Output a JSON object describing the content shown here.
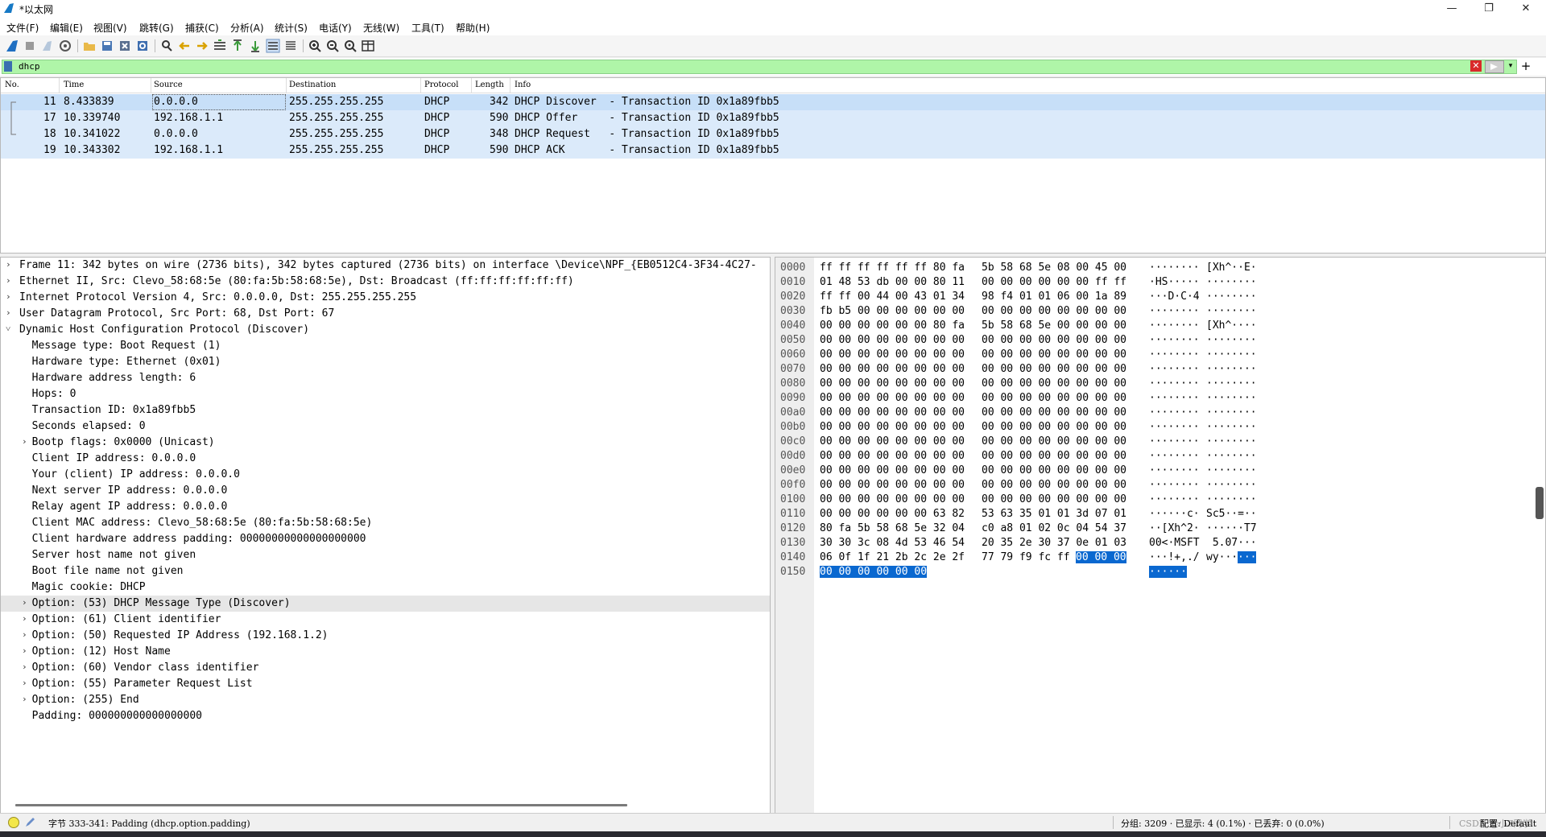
{
  "window": {
    "title": "*以太网",
    "minimize": "—",
    "maximize": "❐",
    "close": "✕"
  },
  "menu": [
    "文件(F)",
    "编辑(E)",
    "视图(V)",
    "跳转(G)",
    "捕获(C)",
    "分析(A)",
    "统计(S)",
    "电话(Y)",
    "无线(W)",
    "工具(T)",
    "帮助(H)"
  ],
  "toolbar_icons": [
    "shark-start-icon",
    "stop-icon",
    "restart-icon",
    "options-icon",
    "open-file-icon",
    "save-file-icon",
    "close-file-icon",
    "reload-icon",
    "find-icon",
    "go-back-icon",
    "go-forward-icon",
    "go-to-packet-icon",
    "first-packet-icon",
    "last-packet-icon",
    "autoscroll-icon",
    "colorize-icon",
    "zoom-in-icon",
    "zoom-out-icon",
    "normal-size-icon",
    "resize-columns-icon"
  ],
  "filter": {
    "value": "dhcp",
    "clear": "✕",
    "dropdown": "▾",
    "add": "+"
  },
  "packet_list": {
    "columns": [
      "No.",
      "Time",
      "Source",
      "Destination",
      "Protocol",
      "Length",
      "Info"
    ],
    "rows": [
      {
        "no": "11",
        "time": "8.433839",
        "source": "0.0.0.0",
        "destination": "255.255.255.255",
        "protocol": "DHCP",
        "length": "342",
        "info": "DHCP Discover  - Transaction ID 0x1a89fbb5"
      },
      {
        "no": "17",
        "time": "10.339740",
        "source": "192.168.1.1",
        "destination": "255.255.255.255",
        "protocol": "DHCP",
        "length": "590",
        "info": "DHCP Offer     - Transaction ID 0x1a89fbb5"
      },
      {
        "no": "18",
        "time": "10.341022",
        "source": "0.0.0.0",
        "destination": "255.255.255.255",
        "protocol": "DHCP",
        "length": "348",
        "info": "DHCP Request   - Transaction ID 0x1a89fbb5"
      },
      {
        "no": "19",
        "time": "10.343302",
        "source": "192.168.1.1",
        "destination": "255.255.255.255",
        "protocol": "DHCP",
        "length": "590",
        "info": "DHCP ACK       - Transaction ID 0x1a89fbb5"
      }
    ]
  },
  "details": [
    {
      "arrow": "›",
      "text": "Frame 11: 342 bytes on wire (2736 bits), 342 bytes captured (2736 bits) on interface \\Device\\NPF_{EB0512C4-3F34-4C27-"
    },
    {
      "arrow": "›",
      "text": "Ethernet II, Src: Clevo_58:68:5e (80:fa:5b:58:68:5e), Dst: Broadcast (ff:ff:ff:ff:ff:ff)"
    },
    {
      "arrow": "›",
      "text": "Internet Protocol Version 4, Src: 0.0.0.0, Dst: 255.255.255.255"
    },
    {
      "arrow": "›",
      "text": "User Datagram Protocol, Src Port: 68, Dst Port: 67"
    },
    {
      "arrow": "˅",
      "text": "Dynamic Host Configuration Protocol (Discover)"
    },
    {
      "arrow": "",
      "text": "  Message type: Boot Request (1)"
    },
    {
      "arrow": "",
      "text": "  Hardware type: Ethernet (0x01)"
    },
    {
      "arrow": "",
      "text": "  Hardware address length: 6"
    },
    {
      "arrow": "",
      "text": "  Hops: 0"
    },
    {
      "arrow": "",
      "text": "  Transaction ID: 0x1a89fbb5"
    },
    {
      "arrow": "",
      "text": "  Seconds elapsed: 0"
    },
    {
      "arrow": "›",
      "text": "  Bootp flags: 0x0000 (Unicast)"
    },
    {
      "arrow": "",
      "text": "  Client IP address: 0.0.0.0"
    },
    {
      "arrow": "",
      "text": "  Your (client) IP address: 0.0.0.0"
    },
    {
      "arrow": "",
      "text": "  Next server IP address: 0.0.0.0"
    },
    {
      "arrow": "",
      "text": "  Relay agent IP address: 0.0.0.0"
    },
    {
      "arrow": "",
      "text": "  Client MAC address: Clevo_58:68:5e (80:fa:5b:58:68:5e)"
    },
    {
      "arrow": "",
      "text": "  Client hardware address padding: 00000000000000000000"
    },
    {
      "arrow": "",
      "text": "  Server host name not given"
    },
    {
      "arrow": "",
      "text": "  Boot file name not given"
    },
    {
      "arrow": "",
      "text": "  Magic cookie: DHCP"
    },
    {
      "arrow": "›",
      "text": "  Option: (53) DHCP Message Type (Discover)",
      "highlight": true
    },
    {
      "arrow": "›",
      "text": "  Option: (61) Client identifier"
    },
    {
      "arrow": "›",
      "text": "  Option: (50) Requested IP Address (192.168.1.2)"
    },
    {
      "arrow": "›",
      "text": "  Option: (12) Host Name"
    },
    {
      "arrow": "›",
      "text": "  Option: (60) Vendor class identifier"
    },
    {
      "arrow": "›",
      "text": "  Option: (55) Parameter Request List"
    },
    {
      "arrow": "›",
      "text": "  Option: (255) End"
    },
    {
      "arrow": "",
      "text": "  Padding: 000000000000000000"
    }
  ],
  "bytes": [
    {
      "off": "0000",
      "h1": "ff ff ff ff ff ff 80 fa",
      "h2": "5b 58 68 5e 08 00 45 00",
      "a1": "········",
      "a2": "[Xh^··E·"
    },
    {
      "off": "0010",
      "h1": "01 48 53 db 00 00 80 11",
      "h2": "00 00 00 00 00 00 ff ff",
      "a1": "·HS·····",
      "a2": "········"
    },
    {
      "off": "0020",
      "h1": "ff ff 00 44 00 43 01 34",
      "h2": "98 f4 01 01 06 00 1a 89",
      "a1": "···D·C·4",
      "a2": "········"
    },
    {
      "off": "0030",
      "h1": "fb b5 00 00 00 00 00 00",
      "h2": "00 00 00 00 00 00 00 00",
      "a1": "········",
      "a2": "········"
    },
    {
      "off": "0040",
      "h1": "00 00 00 00 00 00 80 fa",
      "h2": "5b 58 68 5e 00 00 00 00",
      "a1": "········",
      "a2": "[Xh^····"
    },
    {
      "off": "0050",
      "h1": "00 00 00 00 00 00 00 00",
      "h2": "00 00 00 00 00 00 00 00",
      "a1": "········",
      "a2": "········"
    },
    {
      "off": "0060",
      "h1": "00 00 00 00 00 00 00 00",
      "h2": "00 00 00 00 00 00 00 00",
      "a1": "········",
      "a2": "········"
    },
    {
      "off": "0070",
      "h1": "00 00 00 00 00 00 00 00",
      "h2": "00 00 00 00 00 00 00 00",
      "a1": "········",
      "a2": "········"
    },
    {
      "off": "0080",
      "h1": "00 00 00 00 00 00 00 00",
      "h2": "00 00 00 00 00 00 00 00",
      "a1": "········",
      "a2": "········"
    },
    {
      "off": "0090",
      "h1": "00 00 00 00 00 00 00 00",
      "h2": "00 00 00 00 00 00 00 00",
      "a1": "········",
      "a2": "········"
    },
    {
      "off": "00a0",
      "h1": "00 00 00 00 00 00 00 00",
      "h2": "00 00 00 00 00 00 00 00",
      "a1": "········",
      "a2": "········"
    },
    {
      "off": "00b0",
      "h1": "00 00 00 00 00 00 00 00",
      "h2": "00 00 00 00 00 00 00 00",
      "a1": "········",
      "a2": "········"
    },
    {
      "off": "00c0",
      "h1": "00 00 00 00 00 00 00 00",
      "h2": "00 00 00 00 00 00 00 00",
      "a1": "········",
      "a2": "········"
    },
    {
      "off": "00d0",
      "h1": "00 00 00 00 00 00 00 00",
      "h2": "00 00 00 00 00 00 00 00",
      "a1": "········",
      "a2": "········"
    },
    {
      "off": "00e0",
      "h1": "00 00 00 00 00 00 00 00",
      "h2": "00 00 00 00 00 00 00 00",
      "a1": "········",
      "a2": "········"
    },
    {
      "off": "00f0",
      "h1": "00 00 00 00 00 00 00 00",
      "h2": "00 00 00 00 00 00 00 00",
      "a1": "········",
      "a2": "········"
    },
    {
      "off": "0100",
      "h1": "00 00 00 00 00 00 00 00",
      "h2": "00 00 00 00 00 00 00 00",
      "a1": "········",
      "a2": "········"
    },
    {
      "off": "0110",
      "h1": "00 00 00 00 00 00 63 82",
      "h2": "53 63 35 01 01 3d 07 01",
      "a1": "······c·",
      "a2": "Sc5··=··"
    },
    {
      "off": "0120",
      "h1": "80 fa 5b 58 68 5e 32 04",
      "h2": "c0 a8 01 02 0c 04 54 37",
      "a1": "··[Xh^2·",
      "a2": "······T7"
    },
    {
      "off": "0130",
      "h1": "30 30 3c 08 4d 53 46 54",
      "h2": "20 35 2e 30 37 0e 01 03",
      "a1": "00<·MSFT",
      "a2": " 5.07···"
    },
    {
      "off": "0140",
      "h1": "06 0f 1f 21 2b 2c 2e 2f",
      "h2": "77 79 f9 fc ff ",
      "h2sel": "00 00 00",
      "a1": "···!+,./",
      "a2": "wy···",
      "a2sel": "···"
    },
    {
      "off": "0150",
      "h1": "",
      "h1sel": "00 00 00 00 00 00",
      "h2": "",
      "a1": "",
      "a1sel": "······",
      "a2": ""
    }
  ],
  "status": {
    "field": "字节 333-341: Padding (dhcp.option.padding)",
    "stats": "分组: 3209 · 已显示: 4 (0.1%) · 已丢弃: 0 (0.0%)",
    "profile": "配置: Default",
    "watermark": "CSDN @小Z同学"
  },
  "colors": {
    "filter_ok": "#aff5a8",
    "row_bg": "#dbeafa",
    "byte_highlight": "#0a68d0"
  }
}
